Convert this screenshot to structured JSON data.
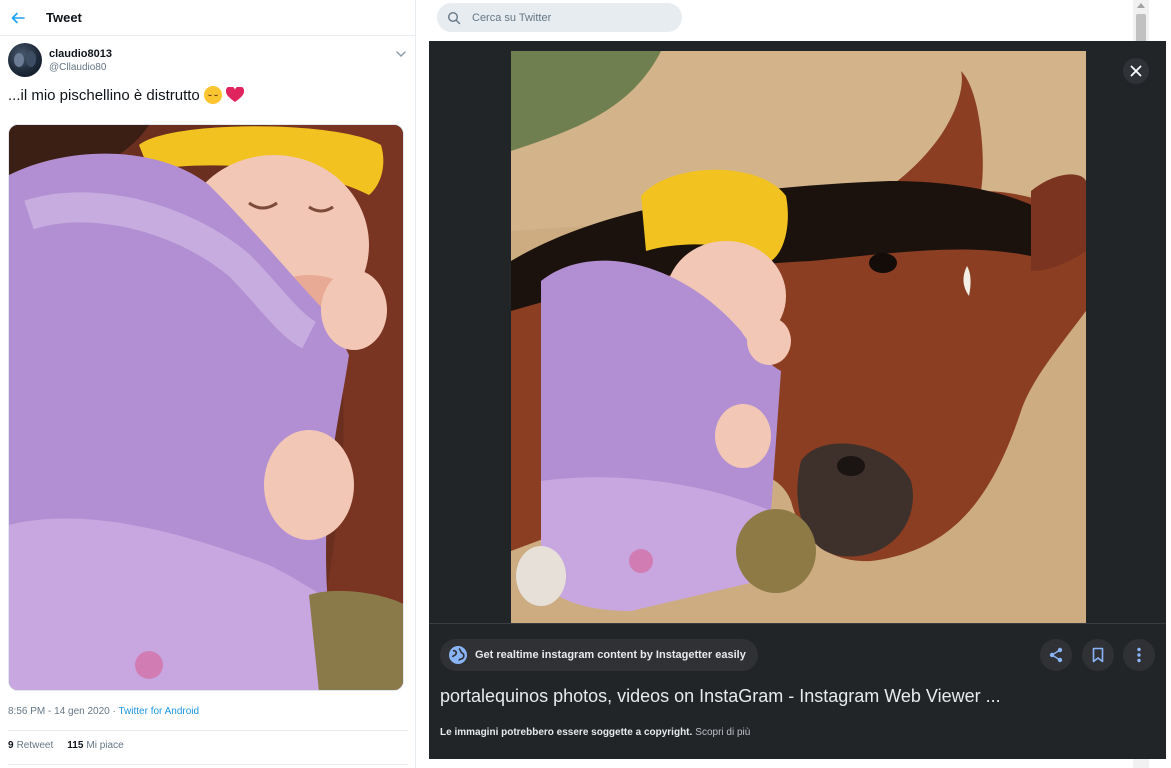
{
  "header": {
    "title": "Tweet"
  },
  "tweet": {
    "author_name": "claudio8013",
    "author_handle": "@Cllaudio80",
    "text": "...il mio pischellino è distrutto",
    "timestamp": "8:56 PM - 14 gen 2020",
    "separator": " · ",
    "client": "Twitter for Android",
    "retweet_count": "9",
    "retweet_label": "Retweet",
    "like_count": "115",
    "like_label": "Mi piace"
  },
  "search": {
    "placeholder": "Cerca su Twitter",
    "value": ""
  },
  "viewer": {
    "source_label": "Get realtime instagram content by Instagetter easily",
    "result_title": "portalequinos photos, videos on InstaGram - Instagram Web Viewer ...",
    "copyright_text": "Le immagini potrebbero essere soggette a copyright.",
    "learn_more": "Scopri di più"
  },
  "colors": {
    "accent": "#1da1f2",
    "link": "#1b95e0",
    "viewer_bg": "#222528",
    "chip_bg": "#303134",
    "heart": "#e0245e"
  },
  "icons": [
    "back-arrow-icon",
    "chevron-down-icon",
    "search-icon",
    "close-icon",
    "globe-icon",
    "share-icon",
    "bookmark-icon",
    "more-vert-icon"
  ]
}
